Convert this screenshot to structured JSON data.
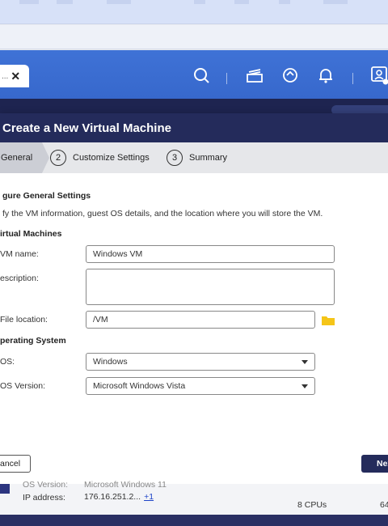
{
  "app_tab": {
    "ellipsis": "...",
    "close": "✕"
  },
  "header_icons": [
    "search-icon",
    "stack-icon",
    "sync-icon",
    "bell-icon",
    "user-icon"
  ],
  "dialog": {
    "title": "Create a New Virtual Machine",
    "steps": [
      {
        "label": "General",
        "active": true
      },
      {
        "num": "2",
        "label": "Customize Settings"
      },
      {
        "num": "3",
        "label": "Summary"
      }
    ],
    "section_title": "gure General Settings",
    "description": "fy the VM information, guest OS details, and the location where you will store the VM.",
    "vm_section": "irtual Machines",
    "vm_name_label": "VM name:",
    "vm_name_value": "Windows VM",
    "description_label": "escription:",
    "file_location_label": "File location:",
    "file_location_value": "/VM",
    "os_section": "perating System",
    "os_label": "OS:",
    "os_value": "Windows",
    "os_version_label": "OS Version:",
    "os_version_value": "Microsoft Windows Vista",
    "cancel_label": "ancel",
    "next_label": "Nex"
  },
  "background": {
    "row1_label": "OS Version:",
    "row1_value": "Microsoft Windows 11",
    "ip_label": "IP address:",
    "ip_value": "176.16.251.2...",
    "ip_more": "+1",
    "cpus": "8 CPUs",
    "mem": "64"
  },
  "colors": {
    "header_blue": "#3c6fd4",
    "dialog_title_bg": "#242b5b",
    "folder": "#f5c518"
  }
}
